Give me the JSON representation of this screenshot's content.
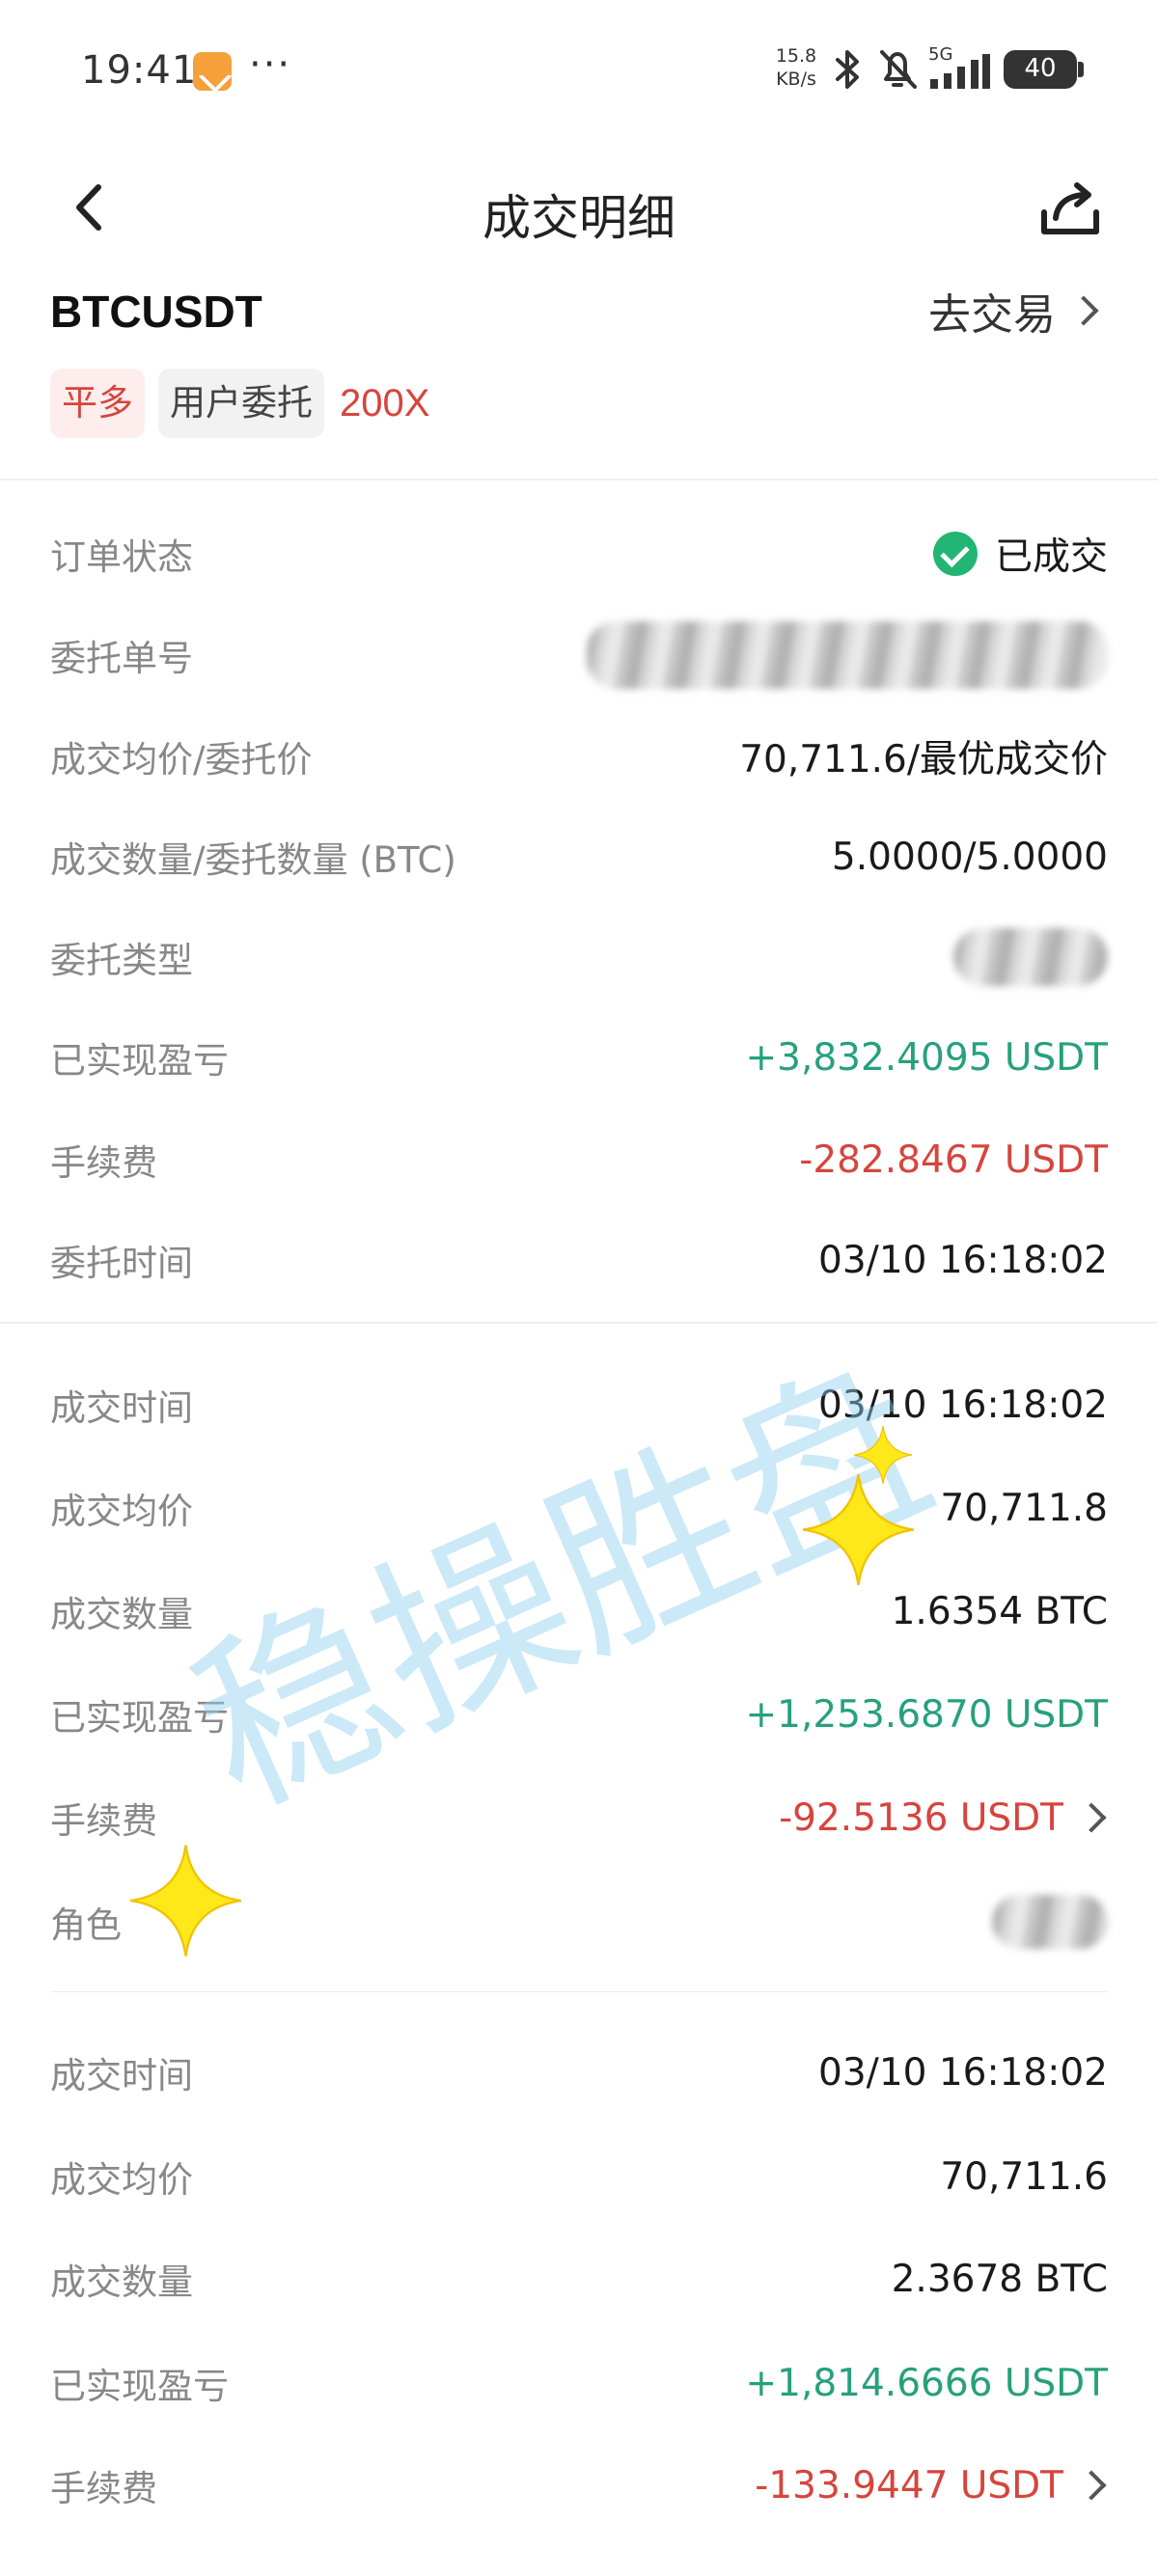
{
  "status_bar": {
    "time": "19:41",
    "dots": "···",
    "speed_value": "15.8",
    "speed_unit": "KB/s",
    "network": "5G",
    "battery": "40",
    "icons": [
      "app-notification-icon",
      "bluetooth-icon",
      "mute-icon",
      "signal-icon",
      "battery-icon"
    ]
  },
  "nav": {
    "title": "成交明细",
    "back_icon": "back-arrow-icon",
    "share_icon": "share-icon"
  },
  "header": {
    "symbol": "BTCUSDT",
    "go_trade": "去交易",
    "tags": {
      "close": "平多",
      "user": "用户委托",
      "leverage": "200X"
    }
  },
  "order": {
    "status_label": "订单状态",
    "status_value": "已成交",
    "order_no_label": "委托单号",
    "avg_price_label": "成交均价/委托价",
    "avg_price_value": "70,711.6/最优成交价",
    "qty_label": "成交数量/委托数量 (BTC)",
    "qty_value": "5.0000/5.0000",
    "type_label": "委托类型",
    "pnl_label": "已实现盈亏",
    "pnl_value": "+3,832.4095 USDT",
    "fee_label": "手续费",
    "fee_value": "-282.8467 USDT",
    "time_label": "委托时间",
    "time_value": "03/10 16:18:02"
  },
  "fills": [
    {
      "time_label": "成交时间",
      "time_value": "03/10 16:18:02",
      "price_label": "成交均价",
      "price_value": "70,711.8",
      "qty_label": "成交数量",
      "qty_value": "1.6354 BTC",
      "pnl_label": "已实现盈亏",
      "pnl_value": "+1,253.6870 USDT",
      "fee_label": "手续费",
      "fee_value": "-92.5136 USDT",
      "role_label": "角色"
    },
    {
      "time_label": "成交时间",
      "time_value": "03/10 16:18:02",
      "price_label": "成交均价",
      "price_value": "70,711.6",
      "qty_label": "成交数量",
      "qty_value": "2.3678 BTC",
      "pnl_label": "已实现盈亏",
      "pnl_value": "+1,814.6666 USDT",
      "fee_label": "手续费",
      "fee_value": "-133.9447 USDT"
    }
  ],
  "overlay": {
    "watermark": "稳操胜盘"
  },
  "colors": {
    "positive": "#26a17b",
    "negative": "#d6453d",
    "label_gray": "#888888",
    "status_green": "#22b573"
  }
}
